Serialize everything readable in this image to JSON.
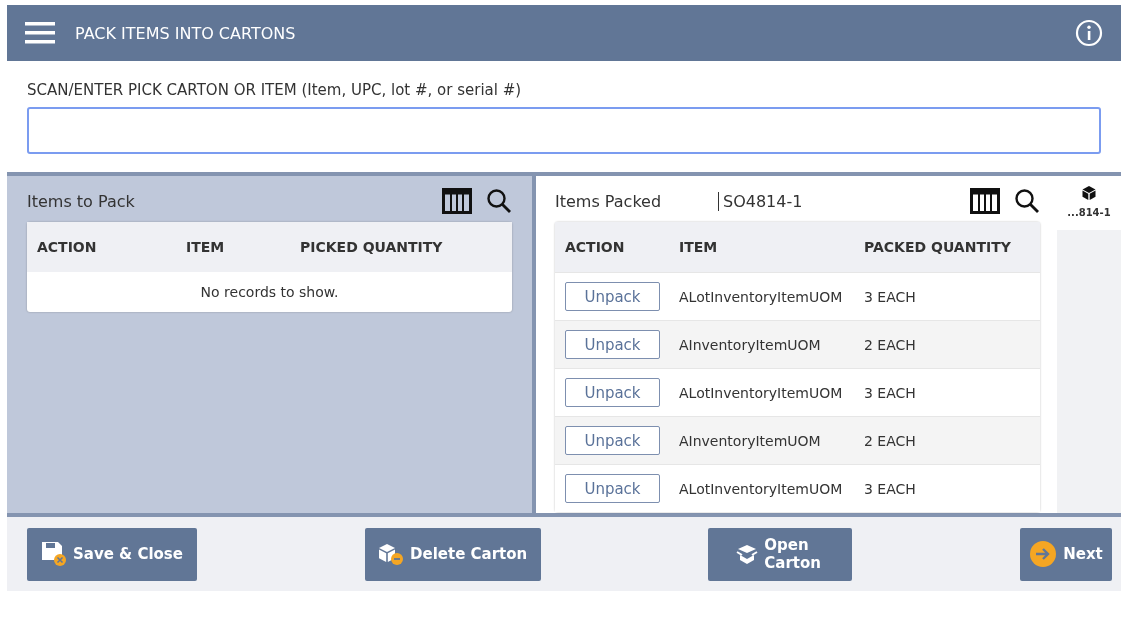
{
  "header": {
    "title": "PACK ITEMS INTO CARTONS"
  },
  "scan": {
    "label": "SCAN/ENTER PICK CARTON OR ITEM (Item, UPC, lot #, or serial #)"
  },
  "items_to_pack": {
    "title": "Items to Pack",
    "columns": [
      "ACTION",
      "ITEM",
      "PICKED QUANTITY"
    ],
    "empty": "No records to show."
  },
  "items_packed": {
    "title": "Items Packed",
    "carton": "SO4814-1",
    "columns": [
      "ACTION",
      "ITEM",
      "PACKED QUANTITY"
    ],
    "rows": [
      {
        "action": "Unpack",
        "item": "ALotInventoryItemUOM",
        "quantity": "3 EACH"
      },
      {
        "action": "Unpack",
        "item": "AInventoryItemUOM",
        "quantity": "2 EACH"
      },
      {
        "action": "Unpack",
        "item": "ALotInventoryItemUOM",
        "quantity": "3 EACH"
      },
      {
        "action": "Unpack",
        "item": "AInventoryItemUOM",
        "quantity": "2 EACH"
      },
      {
        "action": "Unpack",
        "item": "ALotInventoryItemUOM",
        "quantity": "3 EACH"
      }
    ]
  },
  "cartons": [
    {
      "label": "...814-1",
      "selected": true
    }
  ],
  "buttons": [
    {
      "label": "Save & Close",
      "kind": "save"
    },
    {
      "label": "Delete Carton",
      "kind": "delete"
    },
    {
      "label": "Open Carton",
      "kind": "open"
    },
    {
      "label": "Next",
      "kind": "next"
    }
  ]
}
